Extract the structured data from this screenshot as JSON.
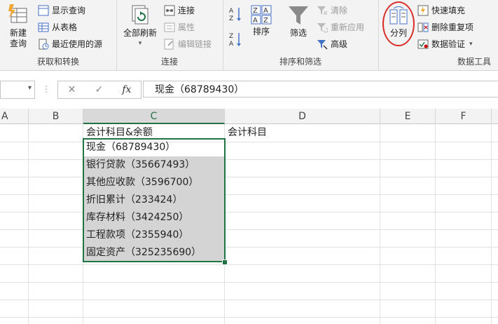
{
  "ribbon": {
    "groups": {
      "get_transform": {
        "label": "获取和转换",
        "new_query": "新建\n查询",
        "items": [
          "显示查询",
          "从表格",
          "最近使用的源"
        ]
      },
      "connections": {
        "label": "连接",
        "refresh_all": "全部刷新",
        "items": [
          "连接",
          "属性",
          "编辑链接"
        ]
      },
      "sort_filter": {
        "label": "排序和筛选",
        "sort": "排序",
        "filter": "筛选",
        "items": [
          "清除",
          "重新应用",
          "高级"
        ]
      },
      "data_tools": {
        "label": "数据工具",
        "split_column": "分列",
        "items": [
          "快速填充",
          "删除重复项",
          "数据验证"
        ]
      }
    }
  },
  "formula_bar": {
    "fx": "fx",
    "cancel": "✕",
    "enter": "✓",
    "value": "现金（68789430）"
  },
  "sheet": {
    "columns": [
      "A",
      "B",
      "C",
      "D",
      "E",
      "F"
    ],
    "selected_column": "C",
    "cells": {
      "c1": "会计科目&余额",
      "d1": "会计科目",
      "c_values": [
        "现金（68789430）",
        "银行贷款（35667493）",
        "其他应收款（3596700）",
        "折旧累计（233424）",
        "库存材料（3424250）",
        "工程款项（2355940）",
        "固定资产（325235690）"
      ]
    }
  },
  "colors": {
    "accent": "#217346",
    "selection_shade": "#d4d4d4",
    "annotation_circle": "#d9302c"
  }
}
